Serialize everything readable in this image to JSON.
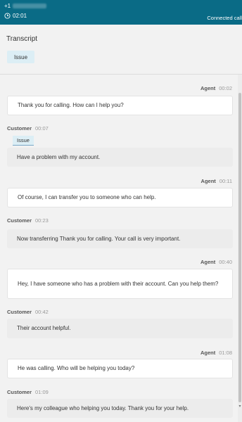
{
  "header": {
    "phone_prefix": "+1",
    "timer": "02:01",
    "status": "Connected call",
    "bg_color": "#0a6b86"
  },
  "section": {
    "title": "Transcript",
    "issue_chip": "Issue"
  },
  "messages": [
    {
      "speaker": "Agent",
      "time": "00:02",
      "text": "Thank you for calling. How can I help you?"
    },
    {
      "speaker": "Customer",
      "time": "00:07",
      "tag": "Issue",
      "text": "Have a problem with my account."
    },
    {
      "speaker": "Agent",
      "time": "00:11",
      "text": "Of course, I can transfer you to someone who can help."
    },
    {
      "speaker": "Customer",
      "time": "00:23",
      "text": "Now transferring Thank you for calling. Your call is very important."
    },
    {
      "speaker": "Agent",
      "time": "00:40",
      "text": "Hey, I have someone who has a problem with their account. Can you help them?"
    },
    {
      "speaker": "Customer",
      "time": "00:42",
      "text": "Their account helpful."
    },
    {
      "speaker": "Agent",
      "time": "01:08",
      "text": "He was calling. Who will be helping you today?"
    },
    {
      "speaker": "Customer",
      "time": "01:09",
      "text": "Here's my colleague who helping you today. Thank you for your help."
    }
  ],
  "icons": {
    "clock": "clock-icon",
    "scroll_down": "chevron-down-icon"
  }
}
